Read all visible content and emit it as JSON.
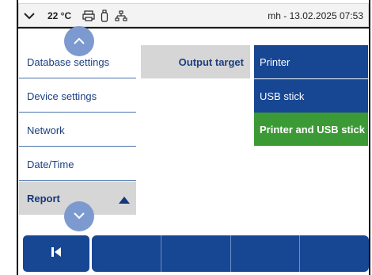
{
  "statusbar": {
    "chevron_icon": "chevron-down-icon",
    "temperature": "22 °C",
    "printer_icon": "printer-icon",
    "usb_icon": "usb-icon",
    "network_icon": "network-icon",
    "user_datetime": "mh - 13.02.2025 07:53"
  },
  "sidebar": {
    "items": [
      {
        "label": "Database settings"
      },
      {
        "label": "Device settings"
      },
      {
        "label": "Network"
      },
      {
        "label": "Date/Time"
      },
      {
        "label": "Report"
      }
    ],
    "scroll_up_icon": "chevron-up-icon",
    "scroll_down_icon": "chevron-down-icon",
    "expand_icon": "triangle-up-icon"
  },
  "content": {
    "output_target_label": "Output target",
    "options": [
      {
        "label": "Printer",
        "selected": false
      },
      {
        "label": "USB stick",
        "selected": false
      },
      {
        "label": "Printer and USB stick",
        "selected": true
      }
    ]
  },
  "bottombar": {
    "back_icon": "skip-back-icon",
    "slots": 4
  },
  "colors": {
    "primary_blue": "#174693",
    "selected_green": "#3b9a35",
    "menu_text": "#1c3f80",
    "active_bg": "#d6d6d6",
    "scroll_button": "#7d9ad0"
  }
}
